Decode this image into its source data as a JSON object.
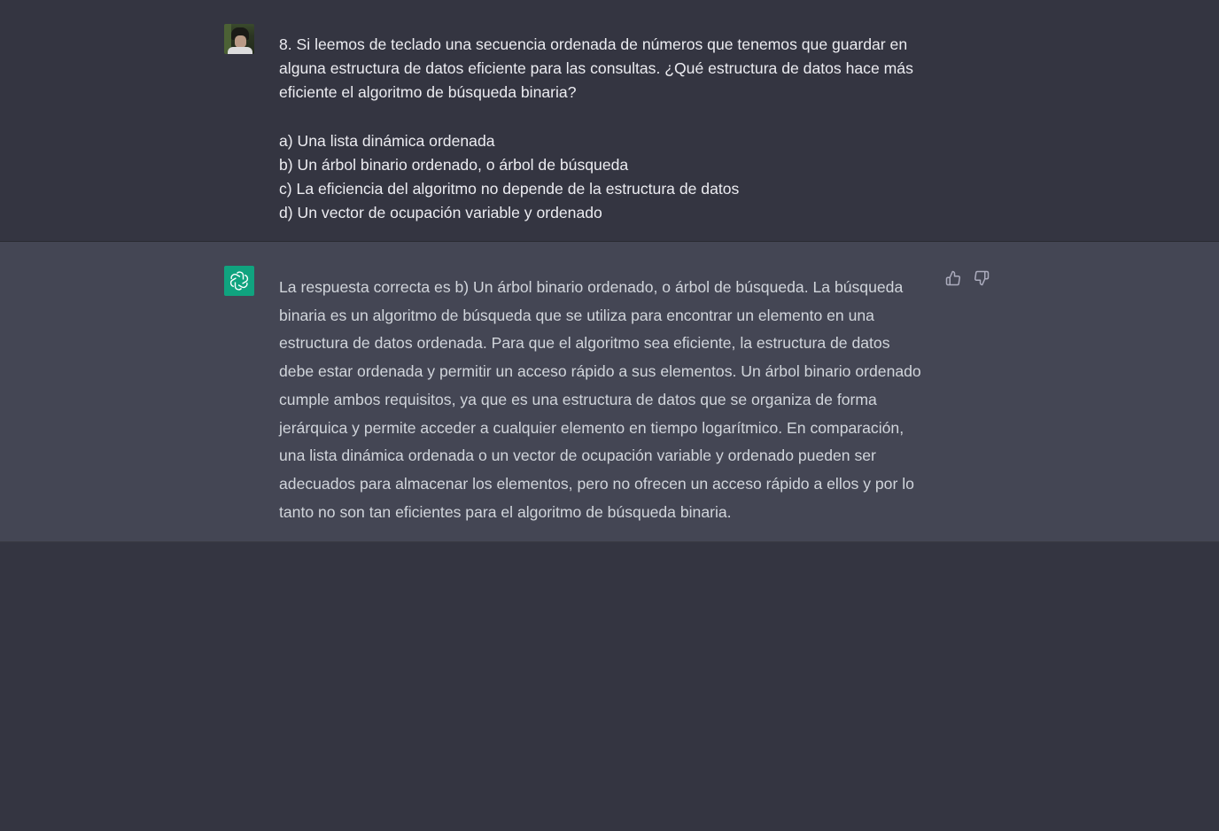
{
  "conversation": {
    "user_message": {
      "avatar_icon": "user-photo-avatar",
      "question": "8. Si leemos de teclado una secuencia ordenada de números que tenemos que guardar en alguna estructura de datos eficiente para las consultas. ¿Qué estructura de datos hace más eficiente el algoritmo de búsqueda binaria?",
      "options": [
        "a) Una lista dinámica ordenada",
        "b) Un árbol binario ordenado, o árbol de búsqueda",
        "c) La eficiencia del algoritmo no depende de la estructura de datos",
        "d) Un vector de ocupación variable y ordenado"
      ]
    },
    "assistant_message": {
      "avatar_icon": "openai-logo-icon",
      "avatar_color": "#10a37f",
      "answer": "La respuesta correcta es b) Un árbol binario ordenado, o árbol de búsqueda. La búsqueda binaria es un algoritmo de búsqueda que se utiliza para encontrar un elemento en una estructura de datos ordenada. Para que el algoritmo sea eficiente, la estructura de datos debe estar ordenada y permitir un acceso rápido a sus elementos. Un árbol binario ordenado cumple ambos requisitos, ya que es una estructura de datos que se organiza de forma jerárquica y permite acceder a cualquier elemento en tiempo logarítmico. En comparación, una lista dinámica ordenada o un vector de ocupación variable y ordenado pueden ser adecuados para almacenar los elementos, pero no ofrecen un acceso rápido a ellos y por lo tanto no son tan eficientes para el algoritmo de búsqueda binaria.",
      "feedback": {
        "thumbs_up_icon": "thumbs-up-icon",
        "thumbs_down_icon": "thumbs-down-icon"
      }
    }
  },
  "colors": {
    "background": "#343541",
    "assistant_background": "#444654",
    "text": "#ececf1"
  }
}
